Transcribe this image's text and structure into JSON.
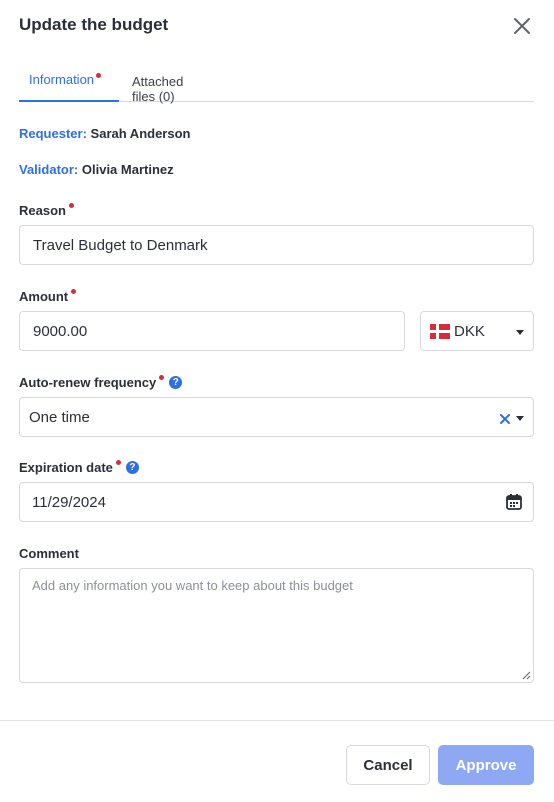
{
  "dialog": {
    "title": "Update the budget"
  },
  "tabs": [
    {
      "label": "Information",
      "has_indicator": true,
      "active": true
    },
    {
      "label": "Attached files (0)",
      "active": false
    }
  ],
  "requester": {
    "key": "Requester:",
    "value": "Sarah Anderson"
  },
  "validator": {
    "key": "Validator:",
    "value": "Olivia Martinez"
  },
  "form": {
    "reason": {
      "label": "Reason",
      "required": true,
      "value": "Travel Budget to Denmark"
    },
    "amount": {
      "label": "Amount",
      "required": true,
      "value": "9000.00",
      "currency": "DKK"
    },
    "auto_renew": {
      "label": "Auto-renew frequency",
      "required": true,
      "value": "One time"
    },
    "expiration": {
      "label": "Expiration date",
      "required": true,
      "value": "11/29/2024"
    },
    "comment": {
      "label": "Comment",
      "placeholder": "Add any information you want to keep about this budget",
      "value": ""
    }
  },
  "buttons": {
    "cancel": "Cancel",
    "approve": "Approve"
  },
  "icons": {
    "close": "close-icon",
    "help": "help-icon",
    "flag": "denmark-flag-icon",
    "calendar": "calendar-icon",
    "clear": "clear-icon",
    "dropdown": "chevron-down-icon"
  },
  "colors": {
    "accent": "#2f6fe4",
    "required": "#d32f3b",
    "approve_button": "#8ea8f4"
  }
}
